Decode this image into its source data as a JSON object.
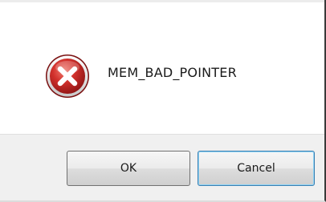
{
  "dialog": {
    "message": "MEM_BAD_POINTER",
    "icon": "error-icon",
    "buttons": {
      "ok_label": "OK",
      "cancel_label": "Cancel"
    },
    "colors": {
      "icon_red": "#c9262a",
      "footer_bg": "#f0f0f0",
      "focus_border": "#3c7fb1"
    }
  }
}
